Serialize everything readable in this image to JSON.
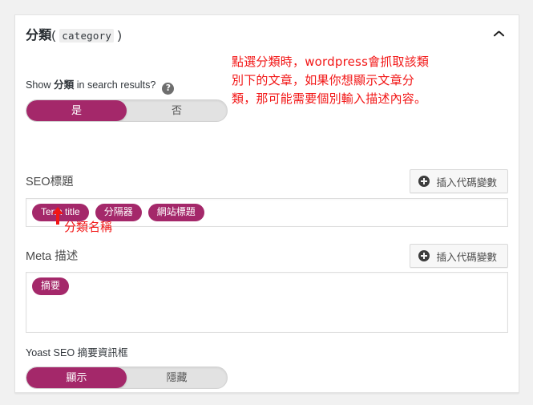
{
  "panel": {
    "title_main": "分類",
    "title_paren_open": "(",
    "title_code": "category",
    "title_paren_close": ")",
    "collapse_icon": "chevron-up-icon"
  },
  "search_results_field": {
    "label_prefix": "Show ",
    "label_term": "分類",
    "label_suffix": " in search results?",
    "help_icon": "question-mark-circle-icon",
    "toggle": {
      "yes_label": "是",
      "no_label": "否",
      "selected": "是"
    }
  },
  "seo_title_field": {
    "label": "SEO標題",
    "insert_button": {
      "icon": "plus-circle-icon",
      "label": "插入代碼變數"
    },
    "pills": [
      "Term title",
      "分隔器",
      "網站標題"
    ]
  },
  "meta_description_field": {
    "label": "Meta 描述",
    "insert_button": {
      "icon": "plus-circle-icon",
      "label": "插入代碼變數"
    },
    "pills": [
      "摘要"
    ]
  },
  "snippet_box_field": {
    "label": "Yoast SEO 摘要資訊框",
    "toggle": {
      "show_label": "顯示",
      "hide_label": "隱藏",
      "selected": "顯示"
    }
  },
  "annotations": {
    "main_note": "點選分類時，wordpress會抓取該類\n別下的文章，如果你想顯示文章分\n類，那可能需要個別輸入描述內容。",
    "term_title_note": "分類名稱"
  },
  "colors": {
    "accent": "#a4286a",
    "annotation": "#f21616",
    "page_bg": "#f1f1f1",
    "panel_bg": "#ffffff"
  }
}
